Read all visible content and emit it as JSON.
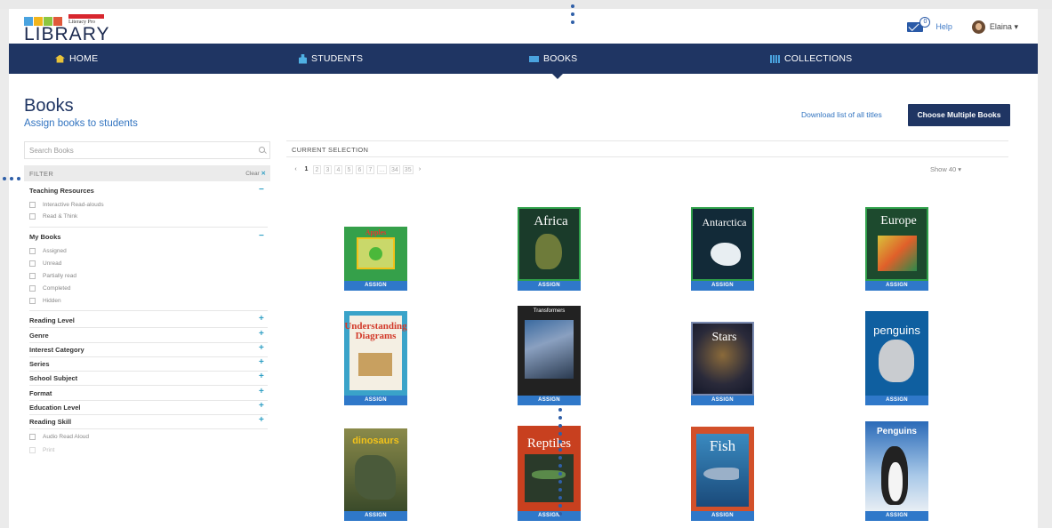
{
  "header": {
    "logo_sub": "Literacy Pro",
    "logo_word": "LIBRARY",
    "mail_count": "0",
    "help_label": "Help",
    "user_name": "Elaina"
  },
  "nav": {
    "items": [
      {
        "label": "HOME"
      },
      {
        "label": "STUDENTS"
      },
      {
        "label": "BOOKS"
      },
      {
        "label": "COLLECTIONS"
      }
    ],
    "active": "BOOKS"
  },
  "page": {
    "title": "Books",
    "subtitle": "Assign books to students",
    "download_link": "Download list of all titles",
    "choose_button": "Choose Multiple Books"
  },
  "sidebar": {
    "search_placeholder": "Search Books",
    "filter_label": "FILTER",
    "clear_label": "Clear",
    "sections": [
      {
        "title": "Teaching Resources",
        "toggle": "−",
        "options": [
          "Interactive Read-alouds",
          "Read & Think"
        ]
      },
      {
        "title": "My Books",
        "toggle": "−",
        "options": [
          "Assigned",
          "Unread",
          "Partially read",
          "Completed",
          "Hidden"
        ]
      },
      {
        "title": "Reading Level",
        "toggle": "+"
      },
      {
        "title": "Genre",
        "toggle": "+"
      },
      {
        "title": "Interest Category",
        "toggle": "+"
      },
      {
        "title": "Series",
        "toggle": "+"
      },
      {
        "title": "School Subject",
        "toggle": "+"
      },
      {
        "title": "Format",
        "toggle": "+"
      },
      {
        "title": "Education Level",
        "toggle": "+"
      },
      {
        "title": "Reading Skill",
        "toggle": "+",
        "options": [
          "Audio Read Aloud",
          "Print"
        ]
      }
    ]
  },
  "main": {
    "current_selection_label": "CURRENT SELECTION",
    "pager": [
      "‹",
      "1",
      "2",
      "3",
      "4",
      "5",
      "6",
      "7",
      "…",
      "34",
      "35",
      "›"
    ],
    "show_label": "Show 40",
    "assign_label": "ASSIGN",
    "books": [
      {
        "title": "Apples",
        "color": "#35a04a"
      },
      {
        "title": "Africa",
        "color": "#1f6f3c"
      },
      {
        "title": "Antarctica",
        "color": "#1d5e3a"
      },
      {
        "title": "Europe",
        "color": "#1f6a3a"
      },
      {
        "title": "Understanding Diagrams",
        "color": "#3aa3c9"
      },
      {
        "title": "Transformers",
        "color": "#2a2a2a"
      },
      {
        "title": "Stars",
        "color": "#22344a"
      },
      {
        "title": "penguins",
        "color": "#0f5fa0"
      },
      {
        "title": "dinosaurs",
        "color": "#6a6a3a"
      },
      {
        "title": "Reptiles",
        "color": "#c8401f"
      },
      {
        "title": "Fish",
        "color": "#2a6aa0"
      },
      {
        "title": "Penguins",
        "color": "#7aa8d8"
      }
    ]
  }
}
